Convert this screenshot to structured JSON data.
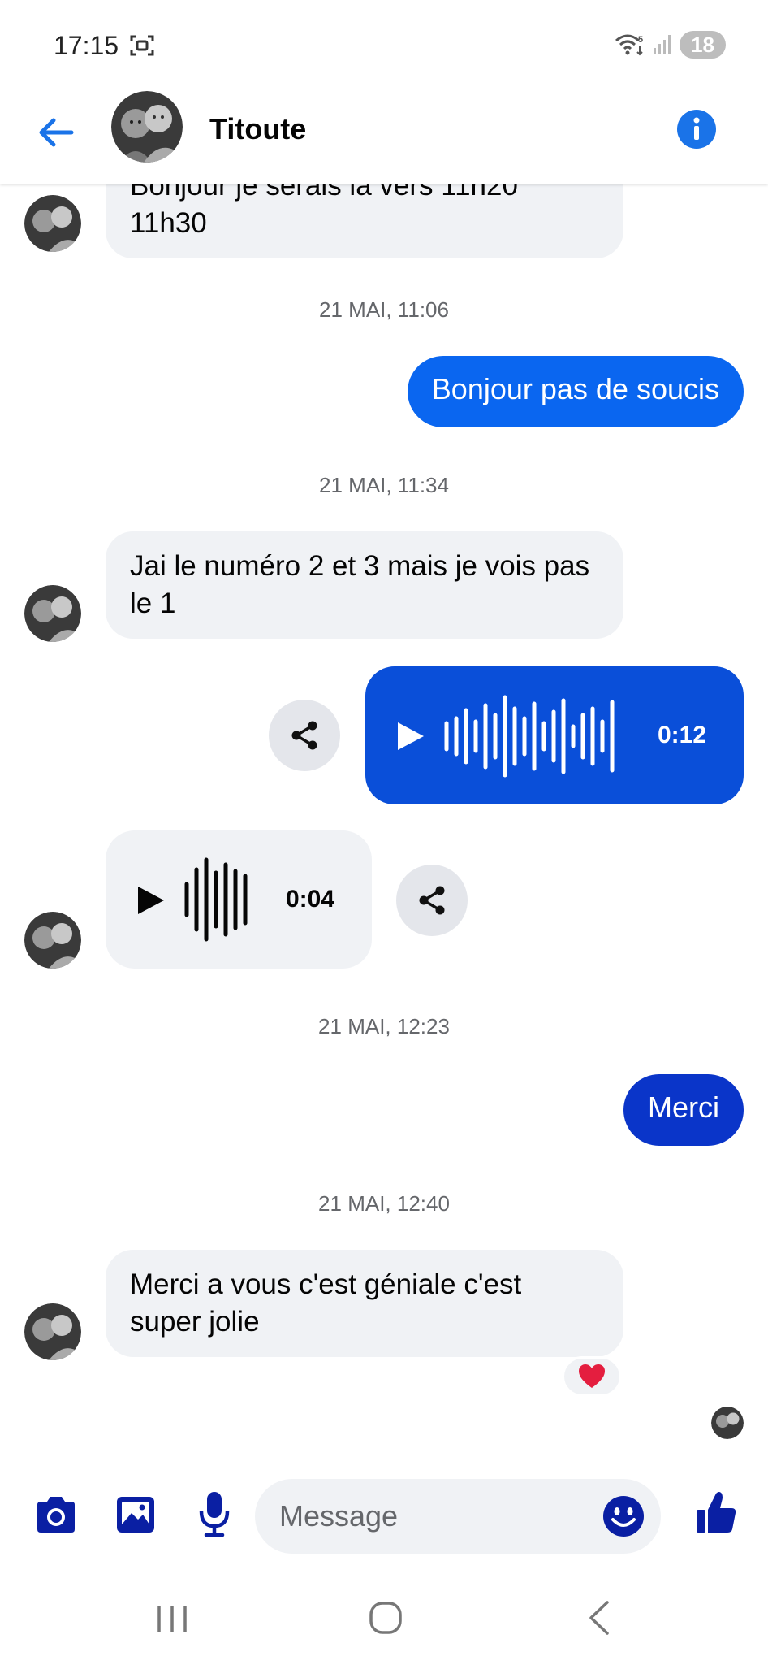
{
  "status_bar": {
    "time": "17:15",
    "battery": "18"
  },
  "header": {
    "contact_name": "Titoute"
  },
  "messages": {
    "first_in_text_partial": "Bonjour je serais la vers 11h20",
    "first_in_text_line2": "11h30",
    "ts1": "21 MAI, 11:06",
    "out1": "Bonjour pas de soucis",
    "ts2": "21 MAI, 11:34",
    "in2": "Jai le numéro 2 et 3 mais je vois pas le 1",
    "audio_out_duration": "0:12",
    "audio_in_duration": "0:04",
    "ts3": "21 MAI, 12:23",
    "out2": "Merci",
    "ts4": "21 MAI, 12:40",
    "in3": "Merci a vous c'est géniale c'est super jolie"
  },
  "composer": {
    "placeholder": "Message"
  },
  "icons": {
    "status": [
      "screen-record-icon",
      "wifi-icon",
      "signal-icon"
    ],
    "header": [
      "back-arrow-icon",
      "info-icon"
    ],
    "composer": [
      "camera-icon",
      "gallery-icon",
      "microphone-icon",
      "emoji-icon",
      "thumbs-up-icon"
    ],
    "nav": [
      "recent-apps-icon",
      "home-icon",
      "back-icon"
    ],
    "reaction": "heart-icon"
  },
  "colors": {
    "accent_blue": "#0a66f0",
    "audio_out_blue": "#0a4fd9",
    "icon_navy": "#0a1fa3",
    "bubble_gray": "#f0f2f5",
    "header_link": "#1a73e8"
  }
}
